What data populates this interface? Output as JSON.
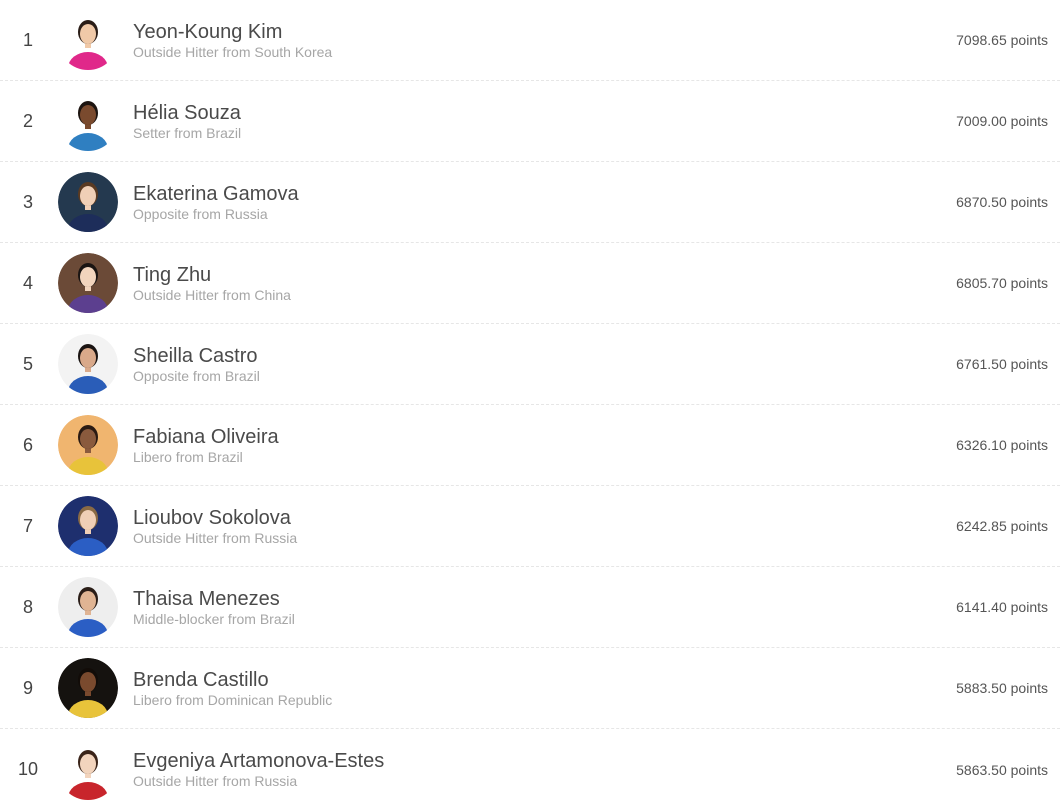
{
  "ranking": {
    "players": [
      {
        "rank": "1",
        "name": "Yeon-Koung Kim",
        "description": "Outside Hitter from South Korea",
        "points": "7098.65 points",
        "avatar_bg": "#ffffff",
        "jersey": "#e0288a",
        "skin": "#f0c9a8",
        "hair": "#2a1d17"
      },
      {
        "rank": "2",
        "name": "Hélia Souza",
        "description": "Setter from Brazil",
        "points": "7009.00 points",
        "avatar_bg": "#ffffff",
        "jersey": "#2f7fc1",
        "skin": "#7a4a2e",
        "hair": "#1c1410"
      },
      {
        "rank": "3",
        "name": "Ekaterina Gamova",
        "description": "Opposite from Russia",
        "points": "6870.50 points",
        "avatar_bg": "#24394f",
        "jersey": "#1d2d5a",
        "skin": "#f0cfb6",
        "hair": "#5a3a22"
      },
      {
        "rank": "4",
        "name": "Ting Zhu",
        "description": "Outside Hitter from China",
        "points": "6805.70 points",
        "avatar_bg": "#6b4a37",
        "jersey": "#5c3f8f",
        "skin": "#f2d4bd",
        "hair": "#1a1412"
      },
      {
        "rank": "5",
        "name": "Sheilla Castro",
        "description": "Opposite from Brazil",
        "points": "6761.50 points",
        "avatar_bg": "#f3f3f3",
        "jersey": "#2a5db8",
        "skin": "#d9a98a",
        "hair": "#1a1412"
      },
      {
        "rank": "6",
        "name": "Fabiana Oliveira",
        "description": "Libero from Brazil",
        "points": "6326.10 points",
        "avatar_bg": "#f0b56f",
        "jersey": "#e8c33a",
        "skin": "#8a5a3d",
        "hair": "#2a1a12"
      },
      {
        "rank": "7",
        "name": "Lioubov Sokolova",
        "description": "Outside Hitter from Russia",
        "points": "6242.85 points",
        "avatar_bg": "#1e2f6e",
        "jersey": "#2b5ec4",
        "skin": "#f0cfb6",
        "hair": "#8a6a45"
      },
      {
        "rank": "8",
        "name": "Thaisa Menezes",
        "description": "Middle-blocker from Brazil",
        "points": "6141.40 points",
        "avatar_bg": "#eeeeee",
        "jersey": "#2b5ec4",
        "skin": "#e0b493",
        "hair": "#2a1d17"
      },
      {
        "rank": "9",
        "name": "Brenda Castillo",
        "description": "Libero from Dominican Republic",
        "points": "5883.50 points",
        "avatar_bg": "#15120f",
        "jersey": "#e8c33a",
        "skin": "#7a4a2e",
        "hair": "#120c08"
      },
      {
        "rank": "10",
        "name": "Evgeniya Artamonova-Estes",
        "description": "Outside Hitter from Russia",
        "points": "5863.50 points",
        "avatar_bg": "#ffffff",
        "jersey": "#c8252c",
        "skin": "#f2d4bd",
        "hair": "#3a2419"
      }
    ]
  }
}
